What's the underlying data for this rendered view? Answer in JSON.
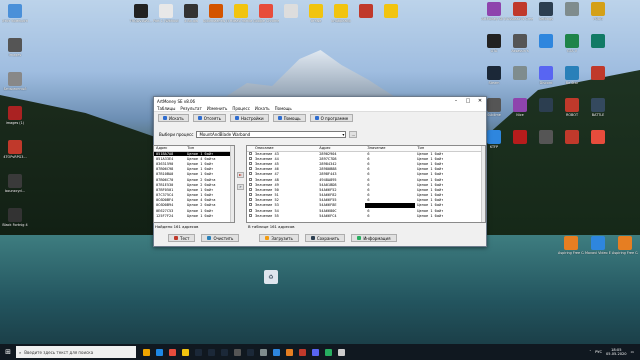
{
  "desktop_icons_left": [
    {
      "label": "Этот компьютер",
      "color": "#4a90d9"
    },
    {
      "label": "images",
      "color": "#555"
    },
    {
      "label": "Безымянный",
      "color": "#888"
    },
    {
      "label": "images (1)",
      "color": "#aa2222"
    },
    {
      "label": "4TOPvRPG3...",
      "color": "#c0392b"
    },
    {
      "label": "bounxcyd...",
      "color": "#3a3a3a"
    },
    {
      "label": "Black Fortnig 4",
      "color": "#333"
    }
  ],
  "desktop_icons_top": [
    {
      "label": "TRQDVLWO...",
      "color": "#222"
    },
    {
      "label": "Part 1 (Without ...)",
      "color": "#e8e8e8"
    },
    {
      "label": "3.8b.ipa",
      "color": "#333"
    },
    {
      "label": "Бриллианты (64)",
      "color": "#d35400"
    },
    {
      "label": "Новая папка",
      "color": "#f1c40f"
    },
    {
      "label": "Google Chrome",
      "color": "#e74c3c"
    },
    {
      "label": "",
      "color": "#ddd"
    },
    {
      "label": "отзыв",
      "color": "#f1c40f"
    },
    {
      "label": "ьнцбрлакр",
      "color": "#f1c40f"
    },
    {
      "label": "",
      "color": "#c0392b"
    },
    {
      "label": "",
      "color": "#f1c40f"
    }
  ],
  "desktop_icons_right": [
    {
      "label": "ArtMoney SE 8",
      "color": "#8e44ad"
    },
    {
      "label": "Assassin's Creed",
      "color": "#c0392b"
    },
    {
      "label": "Settings",
      "color": "#2c3e50"
    },
    {
      "label": "",
      "color": "#7f8c8d"
    },
    {
      "label": "PUBG",
      "color": "#d4a017"
    },
    {
      "label": "GTA",
      "color": "#222"
    },
    {
      "label": "Assassin's",
      "color": "#555"
    },
    {
      "label": "",
      "color": "#2e86de"
    },
    {
      "label": "GTA V",
      "color": "#1e8449"
    },
    {
      "label": "",
      "color": "#117a65"
    },
    {
      "label": "Steam",
      "color": "#1b2838"
    },
    {
      "label": "",
      "color": "#7f8c8d"
    },
    {
      "label": "Discord",
      "color": "#5865f2"
    },
    {
      "label": "Be Star",
      "color": "#2980b9"
    },
    {
      "label": "",
      "color": "#c0392b"
    },
    {
      "label": "Sublime",
      "color": "#555"
    },
    {
      "label": "Nice",
      "color": "#8e44ad"
    },
    {
      "label": "",
      "color": "#2c3e50"
    },
    {
      "label": "ROBOT",
      "color": "#c0392b"
    },
    {
      "label": "BATTLE",
      "color": "#34495e"
    },
    {
      "label": "KTFP",
      "color": "#2e86de"
    },
    {
      "label": "",
      "color": "#b71c1c"
    },
    {
      "label": "",
      "color": "#555"
    },
    {
      "label": "",
      "color": "#c0392b"
    },
    {
      "label": "",
      "color": "#e74c3c"
    }
  ],
  "desktop_icons_bottom_right": [
    {
      "label": "Aspiring Free Cam 8",
      "color": "#e67e22"
    },
    {
      "label": "Movavi Video Editor Plus",
      "color": "#2e86de"
    },
    {
      "label": "Aspiring Free Cam 8",
      "color": "#e67e22"
    }
  ],
  "recycle_label": "",
  "window": {
    "title": "ArtMoney SE v8.06",
    "menu": [
      "Таблицы",
      "Результат",
      "Изменить",
      "Процесс",
      "Искать",
      "Помощь"
    ],
    "toolbar": [
      "Искать",
      "Отсеять",
      "Настройки",
      "Помощь",
      "О программе"
    ],
    "process_label": "Выбери процесс",
    "process_value": "MountAndBlade Warband",
    "left_table": {
      "headers": [
        "Адрес",
        "Тип"
      ],
      "rows": [
        [
          "051BA7A8",
          "Целое 1 байт"
        ],
        [
          "051A33E4",
          "Целое 4 байта"
        ],
        [
          "03631590",
          "Целое 1 байт"
        ],
        [
          "07B06C98",
          "Целое 1 байт"
        ],
        [
          "07B10BA0",
          "Целое 1 байт"
        ],
        [
          "07B06C70",
          "Целое 2 байта"
        ],
        [
          "07B1E530",
          "Целое 2 байта"
        ],
        [
          "07BF0501",
          "Целое 1 байт"
        ],
        [
          "07C375C4",
          "Целое 1 байт"
        ],
        [
          "0C6D0BF4",
          "Целое 4 байта"
        ],
        [
          "0C6D0B94",
          "Целое 2 байта"
        ],
        [
          "0E627C53",
          "Целое 1 байт"
        ],
        [
          "125F7F24",
          "Целое 1 байт"
        ]
      ],
      "found": "Найдено 161 адресов"
    },
    "right_table": {
      "headers": [
        "Описание",
        "Адрес",
        "Значение",
        "Тип"
      ],
      "rows": [
        [
          "Значение 43",
          "28902904",
          "6",
          "Целое 1 байт"
        ],
        [
          "Значение 44",
          "2897C7D8",
          "6",
          "Целое 1 байт"
        ],
        [
          "Значение 45",
          "28984342",
          "6",
          "Целое 1 байт"
        ],
        [
          "Значение 46",
          "28980B88",
          "6",
          "Целое 1 байт"
        ],
        [
          "Значение 47",
          "2898F443",
          "6",
          "Целое 1 байт"
        ],
        [
          "Значение 48",
          "4948A895",
          "6",
          "Целое 1 байт"
        ],
        [
          "Значение 49",
          "54A01BD8",
          "6",
          "Целое 1 байт"
        ],
        [
          "Значение 50",
          "54A66F52",
          "6",
          "Целое 1 байт"
        ],
        [
          "Значение 51",
          "54A66F82",
          "6",
          "Целое 1 байт"
        ],
        [
          "Значение 52",
          "54A66F55",
          "6",
          "Целое 1 байт"
        ],
        [
          "Значение 53",
          "54A66F8E",
          "",
          "Целое 1 байт"
        ],
        [
          "Значение 54",
          "54A6680C",
          "6",
          "Целое 1 байт"
        ],
        [
          "Значение 55",
          "54A66FC4",
          "6",
          "Целое 1 байт"
        ]
      ],
      "found": "В таблице 161 адресов"
    },
    "bottom_buttons": [
      "Тест",
      "Очистить",
      "Загрузить",
      "Сохранить",
      "Информация"
    ]
  },
  "taskbar": {
    "search_placeholder": "Введите здесь текст для поиска",
    "apps": [
      "#f0a500",
      "#1e88e5",
      "#e74c3c",
      "#f1c40f",
      "#1b2838",
      "#1b2838",
      "#1b2838",
      "#555",
      "#1b2838",
      "#7f8c8d",
      "#2e86de",
      "#e67e22",
      "#c0392b",
      "#5865f2",
      "#27ae60",
      "#ccc"
    ],
    "tray_text": "РУС",
    "time": "18:05",
    "date": "05.05.2020"
  }
}
